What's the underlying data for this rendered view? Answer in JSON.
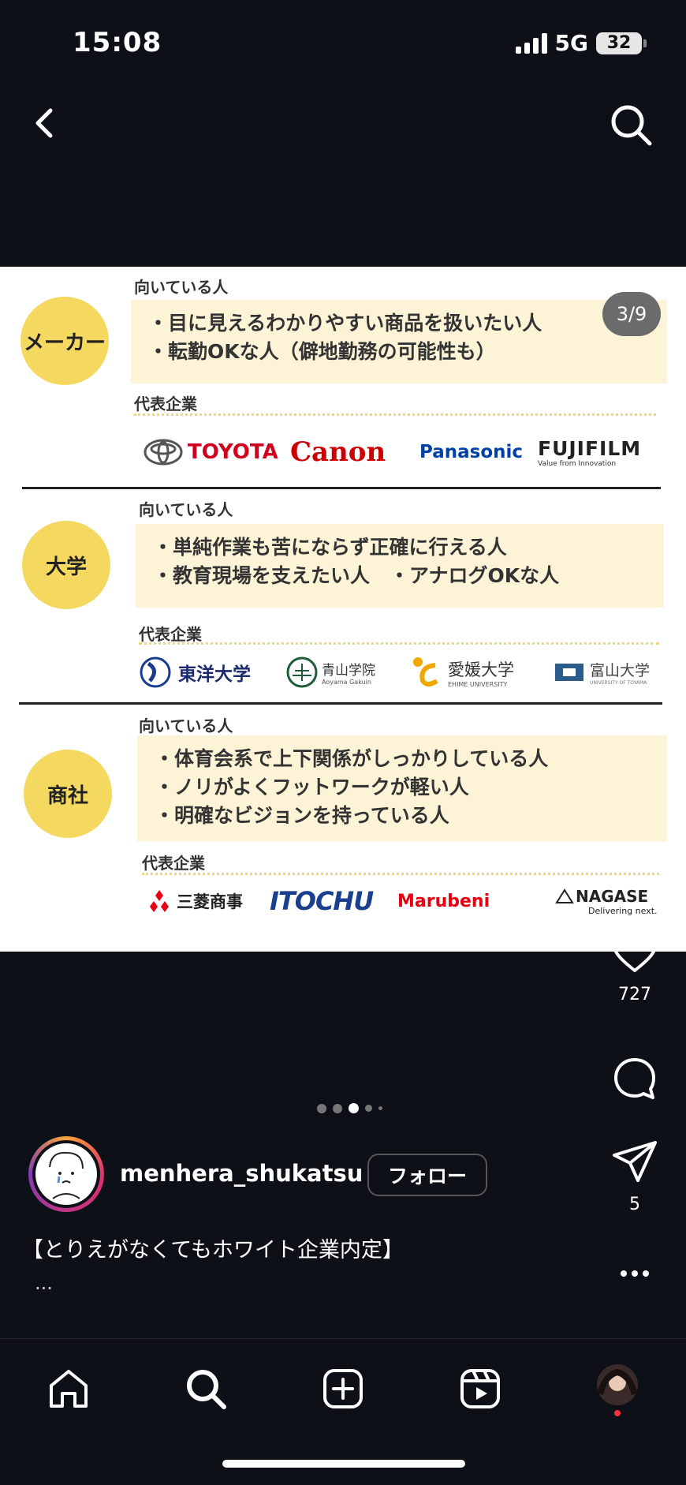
{
  "status": {
    "time": "15:08",
    "network": "5G",
    "battery": "32"
  },
  "post": {
    "counter": "3/9",
    "sections": [
      {
        "category": "メーカー",
        "fit_label": "向いている人",
        "traits": [
          "・目に見えるわかりやすい商品を扱いたい人",
          "・転勤OKな人（僻地勤務の可能性も）"
        ],
        "rep_label": "代表企業",
        "companies": [
          "TOYOTA",
          "Canon",
          "Panasonic",
          "FUJIFILM"
        ],
        "company_sub": {
          "FUJIFILM": "Value from Innovation"
        }
      },
      {
        "category": "大学",
        "fit_label": "向いている人",
        "traits": [
          "・単純作業も苦にならず正確に行える人",
          "・教育現場を支えたい人　・アナログOKな人"
        ],
        "rep_label": "代表企業",
        "companies": [
          "東洋大学",
          "青山学院",
          "愛媛大学",
          "富山大学"
        ],
        "company_sub": {
          "青山学院": "Aoyama Gakuin",
          "愛媛大学": "EHIME UNIVERSITY",
          "富山大学": "UNIVERSITY OF TOYAMA"
        }
      },
      {
        "category": "商社",
        "fit_label": "向いている人",
        "traits": [
          "・体育会系で上下関係がしっかりしている人",
          "・ノリがよくフットワークが軽い人",
          "・明確なビジョンを持っている人"
        ],
        "rep_label": "代表企業",
        "companies": [
          "三菱商事",
          "ITOCHU",
          "Marubeni",
          "NAGASE"
        ],
        "company_sub": {
          "NAGASE": "Delivering next."
        }
      }
    ],
    "likes": "727",
    "shares": "5"
  },
  "profile": {
    "username": "menhera_shukatsu",
    "follow_label": "フォロー"
  },
  "caption": {
    "text": "【とりえがなくてもホワイト企業内定】",
    "more": "..."
  },
  "colors": {
    "background": "#0d1117",
    "accent_yellow": "#f4d860",
    "box_cream": "#fdf4d8",
    "toyota_red": "#d1001c",
    "canon_red": "#cc0000",
    "panasonic_blue": "#0041a8",
    "itochu_blue": "#1b3f8f",
    "marubeni_red": "#e60012",
    "notification_red": "#ff3040"
  },
  "icons": [
    "back-icon",
    "search-icon",
    "heart-icon",
    "comment-icon",
    "share-icon",
    "more-icon",
    "home-icon",
    "search-nav-icon",
    "create-icon",
    "reels-icon",
    "profile-avatar"
  ]
}
